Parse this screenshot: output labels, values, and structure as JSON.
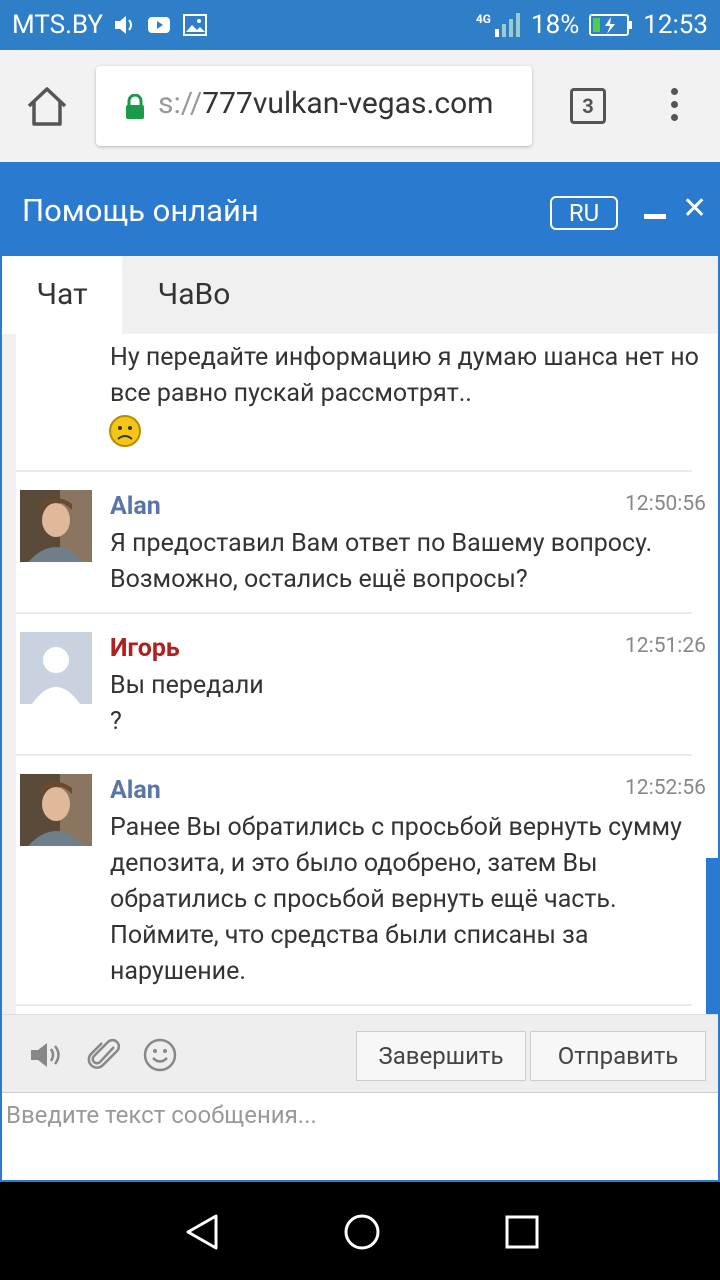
{
  "status_bar": {
    "carrier": "MTS.BY",
    "network": "4G",
    "battery": "18%",
    "time": "12:53"
  },
  "browser": {
    "url_prefix": "s://",
    "url_domain": "777vulkan-vegas.com",
    "tab_count": "3"
  },
  "chat": {
    "title": "Помощь онлайн",
    "language": "RU",
    "tabs": [
      {
        "label": "Чат",
        "active": true
      },
      {
        "label": "ЧаВо",
        "active": false
      }
    ],
    "messages": [
      {
        "author": "",
        "time": "",
        "text": "Ну передайте информацию я думаю шанса нет но все равно пускай рассмотрят..",
        "emoji": "sad-face"
      },
      {
        "author": "Alan",
        "role": "agent",
        "time": "12:50:56",
        "text": "Я предоставил Вам ответ по Вашему вопросу. Возможно, остались ещё вопросы?"
      },
      {
        "author": "Игорь",
        "role": "user",
        "time": "12:51:26",
        "line1": "Вы передали",
        "line2": "?"
      },
      {
        "author": "Alan",
        "role": "agent",
        "time": "12:52:56",
        "text": "Ранее Вы обратились с просьбой вернуть сумму депозита, и это было одобрено, затем Вы обратились с просьбой вернуть ещё часть. Поймите, что средства были списаны за нарушение."
      }
    ],
    "toolbar": {
      "finish_label": "Завершить",
      "send_label": "Отправить"
    },
    "input_placeholder": "Введите текст сообщения..."
  },
  "colors": {
    "accent": "#2a7ad0",
    "agent_name": "#5a76a8",
    "user_name": "#b02020"
  }
}
